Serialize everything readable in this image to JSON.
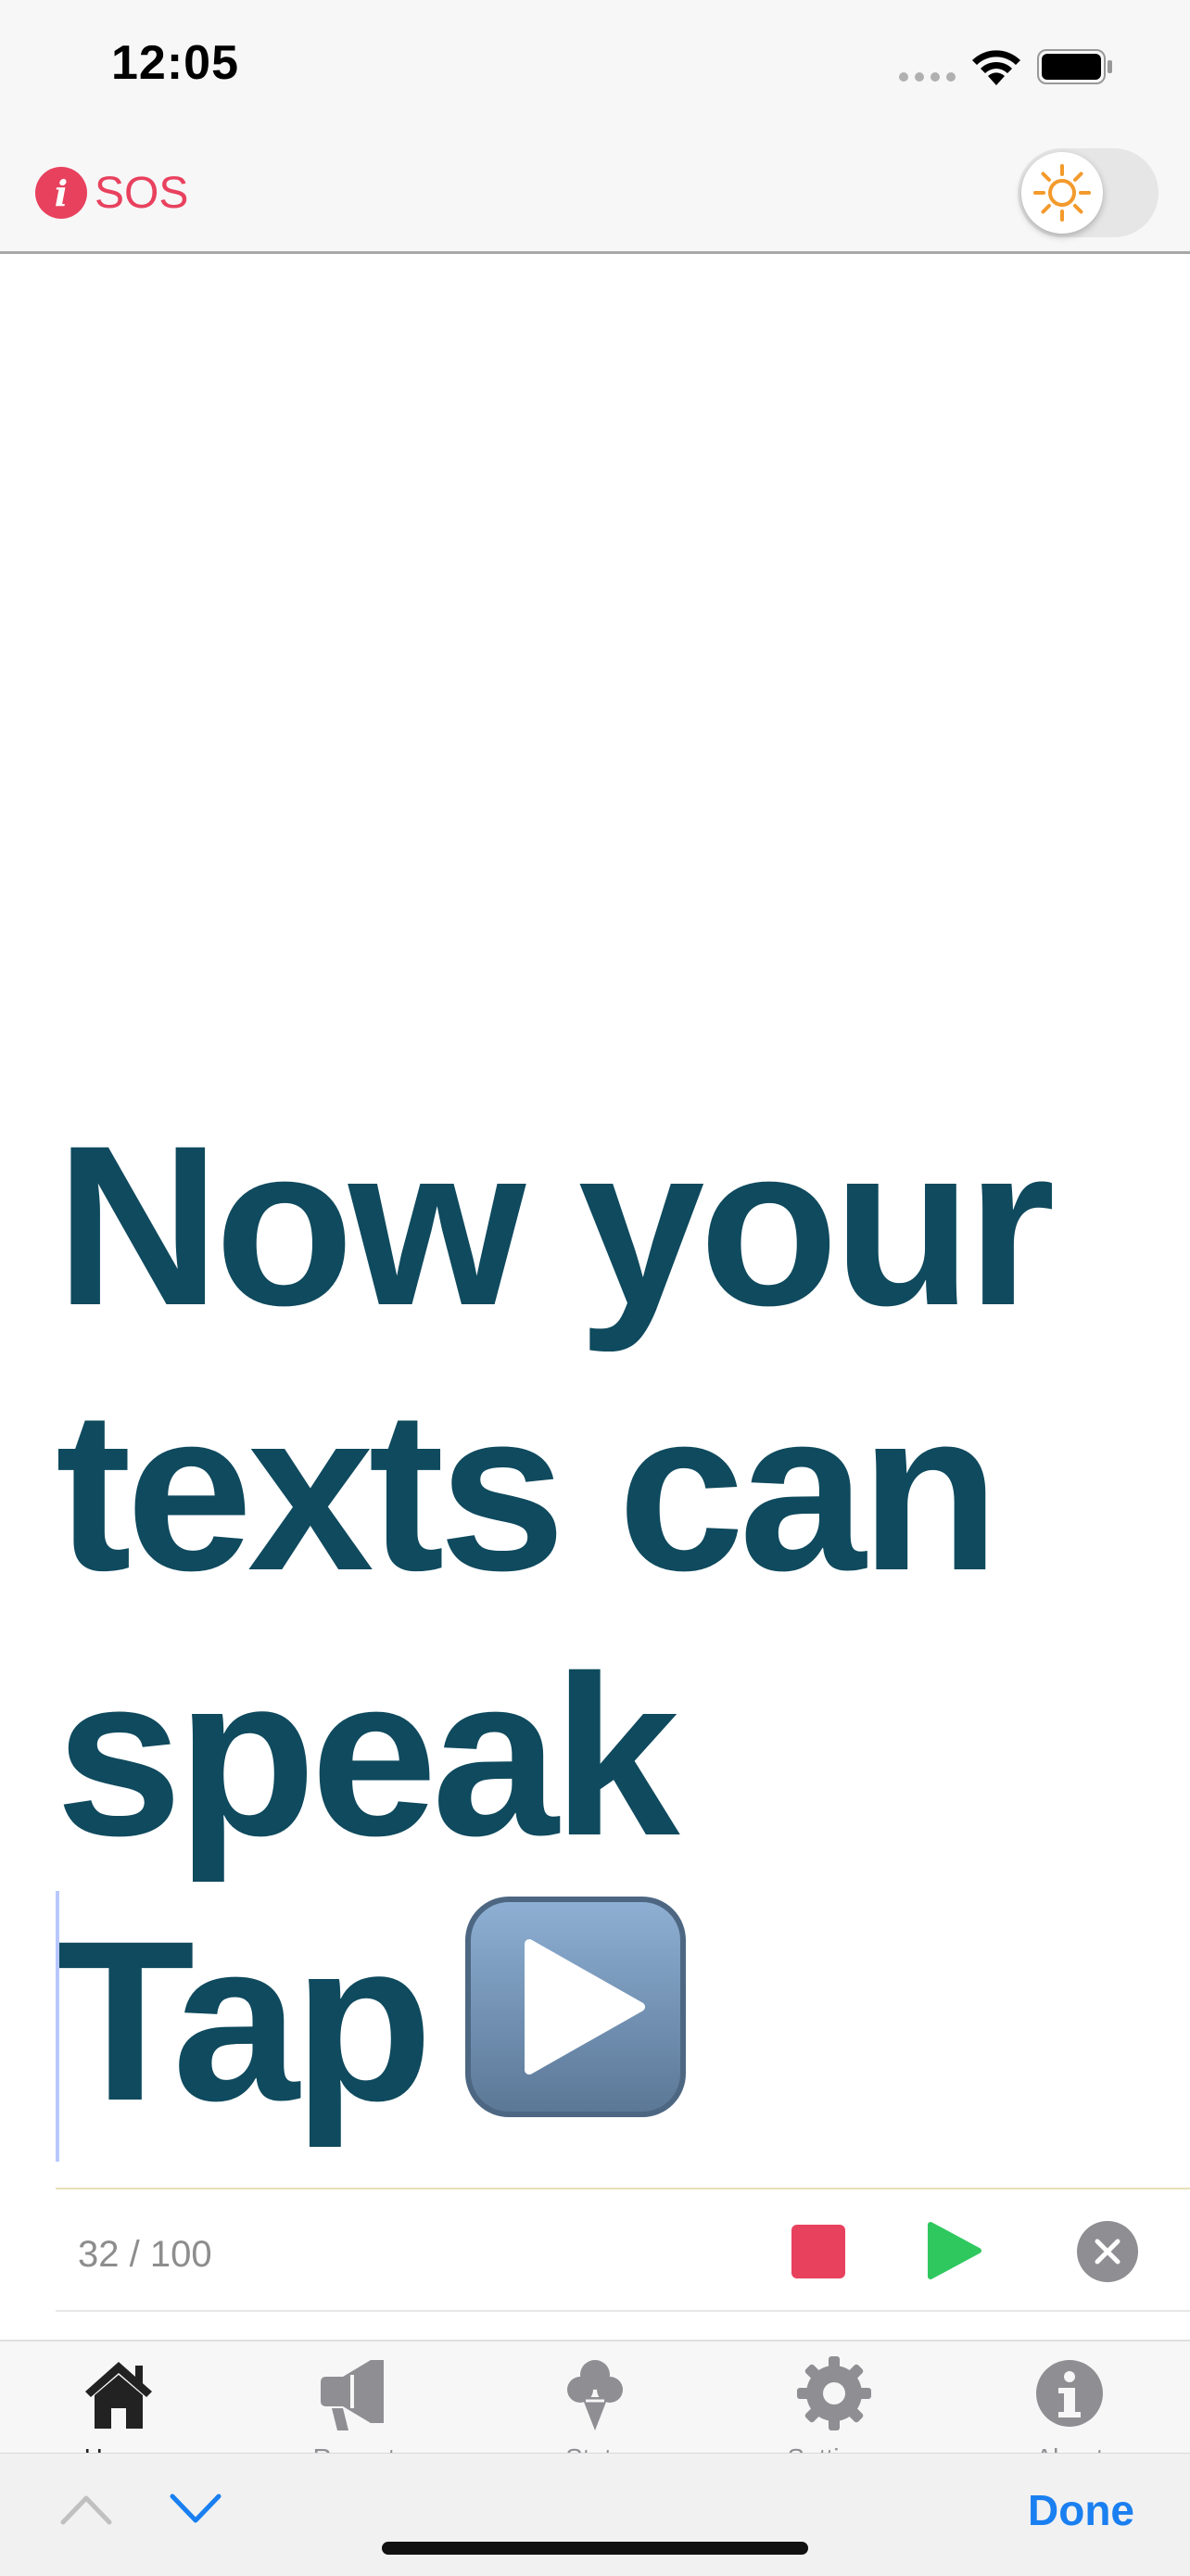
{
  "status_bar": {
    "time": "12:05"
  },
  "nav": {
    "sos_label": "SOS",
    "theme_toggle_on": false
  },
  "editor": {
    "lines": [
      "Now your",
      "texts can",
      "speak",
      "Tap"
    ]
  },
  "input_footer": {
    "counter": "32 / 100"
  },
  "tabs": [
    {
      "label": "Home",
      "icon": "house-icon",
      "active": true
    },
    {
      "label": "Recent",
      "icon": "megaphone-icon",
      "active": false
    },
    {
      "label": "Stats",
      "icon": "ice-cream-icon",
      "active": false
    },
    {
      "label": "Settings",
      "icon": "gear-icon",
      "active": false
    },
    {
      "label": "About",
      "icon": "info-icon",
      "active": false
    }
  ],
  "keyboard_accessory": {
    "done_label": "Done"
  },
  "colors": {
    "accent_red": "#e8415e",
    "text_teal": "#0f4a5e",
    "play_green": "#2fc85f",
    "done_blue": "#1a7ff0"
  }
}
